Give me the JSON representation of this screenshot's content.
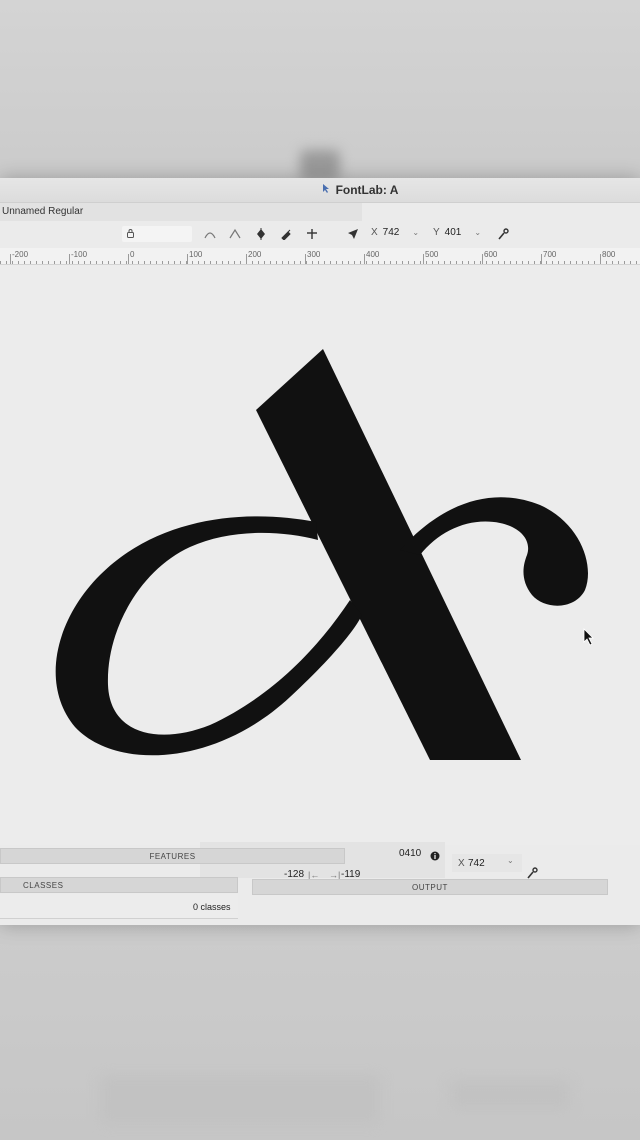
{
  "window": {
    "title": "FontLab: A",
    "font_name": "Unnamed Regular"
  },
  "toolbar": {
    "x_label": "X",
    "x_value": "742",
    "y_label": "Y",
    "y_value": "401"
  },
  "ruler": {
    "labels": [
      "-200",
      "-100",
      "0",
      "100",
      "200",
      "300",
      "400",
      "500",
      "600",
      "700",
      "800"
    ]
  },
  "bottom": {
    "features_label": "FEATURES",
    "classes_label": "CLASSES",
    "classes_count": "0 classes",
    "output_label": "OUTPUT",
    "unicode": "0410",
    "left_sb": "-128",
    "right_sb": "-119",
    "x_label": "X",
    "x_value": "742"
  },
  "glyph": {
    "name": "A",
    "fill": "#111111"
  },
  "icons": {
    "title": "pointer-icon",
    "field": "lock-icon",
    "tools": [
      "smooth-node-icon",
      "corner-node-icon",
      "tangent-node-icon",
      "pen-icon",
      "knife-icon",
      "cursor-arrow-icon",
      "tool-wrench-icon"
    ]
  }
}
